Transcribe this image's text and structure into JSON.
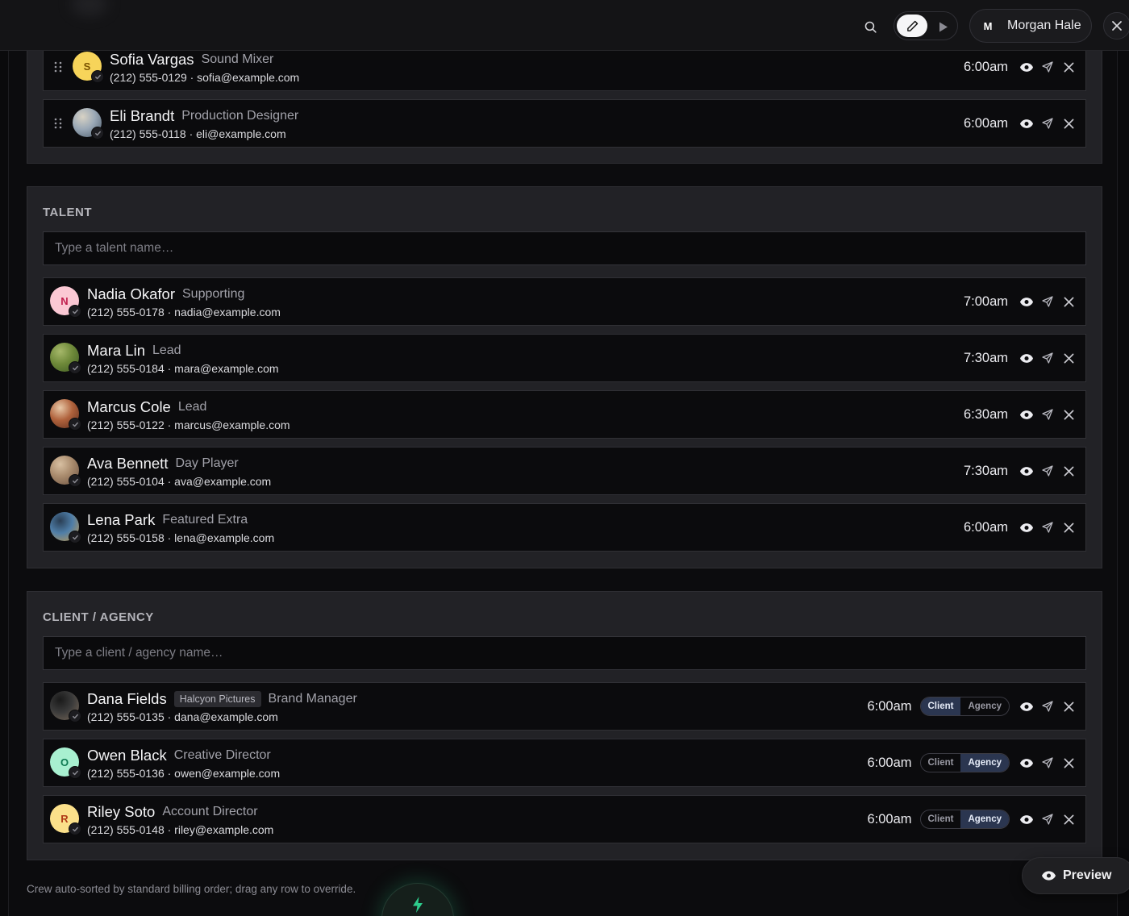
{
  "header": {
    "user": {
      "initial": "M",
      "name": "Morgan Hale"
    }
  },
  "crew_rows": [
    {
      "avatar": {
        "type": "initial",
        "initial": "S",
        "bg": "#f7d45a",
        "fg": "#7a5200"
      },
      "name": "Sofia Vargas",
      "role": "Sound Mixer",
      "contact": "(212) 555-0129 · sofia@example.com",
      "time": "6:00am"
    },
    {
      "avatar": {
        "type": "photo",
        "colors": [
          "#9aa8b6",
          "#4a5a6a",
          "#d8d2c4"
        ]
      },
      "name": "Eli Brandt",
      "role": "Production Designer",
      "contact": "(212) 555-0118 · eli@example.com",
      "time": "6:00am"
    }
  ],
  "talent": {
    "title": "TALENT",
    "placeholder": "Type a talent name…",
    "rows": [
      {
        "avatar": {
          "type": "initial",
          "initial": "N",
          "bg": "#fbc8d4",
          "fg": "#c01d4c"
        },
        "name": "Nadia Okafor",
        "role": "Supporting",
        "contact": "(212) 555-0178 · nadia@example.com",
        "time": "7:00am"
      },
      {
        "avatar": {
          "type": "photo",
          "colors": [
            "#6f8a3a",
            "#3d5a22",
            "#a6b86a"
          ]
        },
        "name": "Mara Lin",
        "role": "Lead",
        "contact": "(212) 555-0184 · mara@example.com",
        "time": "7:30am"
      },
      {
        "avatar": {
          "type": "photo",
          "colors": [
            "#b0623c",
            "#5c2c1c",
            "#e8c9a8"
          ]
        },
        "name": "Marcus Cole",
        "role": "Lead",
        "contact": "(212) 555-0122 · marcus@example.com",
        "time": "6:30am"
      },
      {
        "avatar": {
          "type": "photo",
          "colors": [
            "#a88a6c",
            "#6a5040",
            "#d8c0a2"
          ]
        },
        "name": "Ava Bennett",
        "role": "Day Player",
        "contact": "(212) 555-0104 · ava@example.com",
        "time": "7:30am"
      },
      {
        "avatar": {
          "type": "photo",
          "colors": [
            "#4f7ea8",
            "#c89a4a",
            "#2a3e54"
          ]
        },
        "name": "Lena Park",
        "role": "Featured Extra",
        "contact": "(212) 555-0158 · lena@example.com",
        "time": "6:00am"
      }
    ]
  },
  "client": {
    "title": "CLIENT / AGENCY",
    "placeholder": "Type a client / agency name…",
    "toggle_labels": {
      "client": "Client",
      "agency": "Agency"
    },
    "rows": [
      {
        "avatar": {
          "type": "photo",
          "colors": [
            "#3a3a3a",
            "#7a6a5a",
            "#1a1a1a"
          ]
        },
        "name": "Dana Fields",
        "company": "Halcyon Pictures",
        "role": "Brand Manager",
        "contact": "(212) 555-0135 · dana@example.com",
        "time": "6:00am",
        "selected": "client"
      },
      {
        "avatar": {
          "type": "initial",
          "initial": "O",
          "bg": "#a8f0d0",
          "fg": "#0e7a52"
        },
        "name": "Owen Black",
        "role": "Creative Director",
        "contact": "(212) 555-0136 · owen@example.com",
        "time": "6:00am",
        "selected": "agency"
      },
      {
        "avatar": {
          "type": "initial",
          "initial": "R",
          "bg": "#fbe08a",
          "fg": "#b03a16"
        },
        "name": "Riley Soto",
        "role": "Account Director",
        "contact": "(212) 555-0148 · riley@example.com",
        "time": "6:00am",
        "selected": "agency"
      }
    ]
  },
  "footer": {
    "note": "Crew auto-sorted by standard billing order; drag any row to override.",
    "preview_label": "Preview"
  },
  "colors": {
    "accent_green": "#2ecc8c",
    "toggle_active": "#2b3650",
    "user_avatar_bg": "#1b1b1e"
  }
}
